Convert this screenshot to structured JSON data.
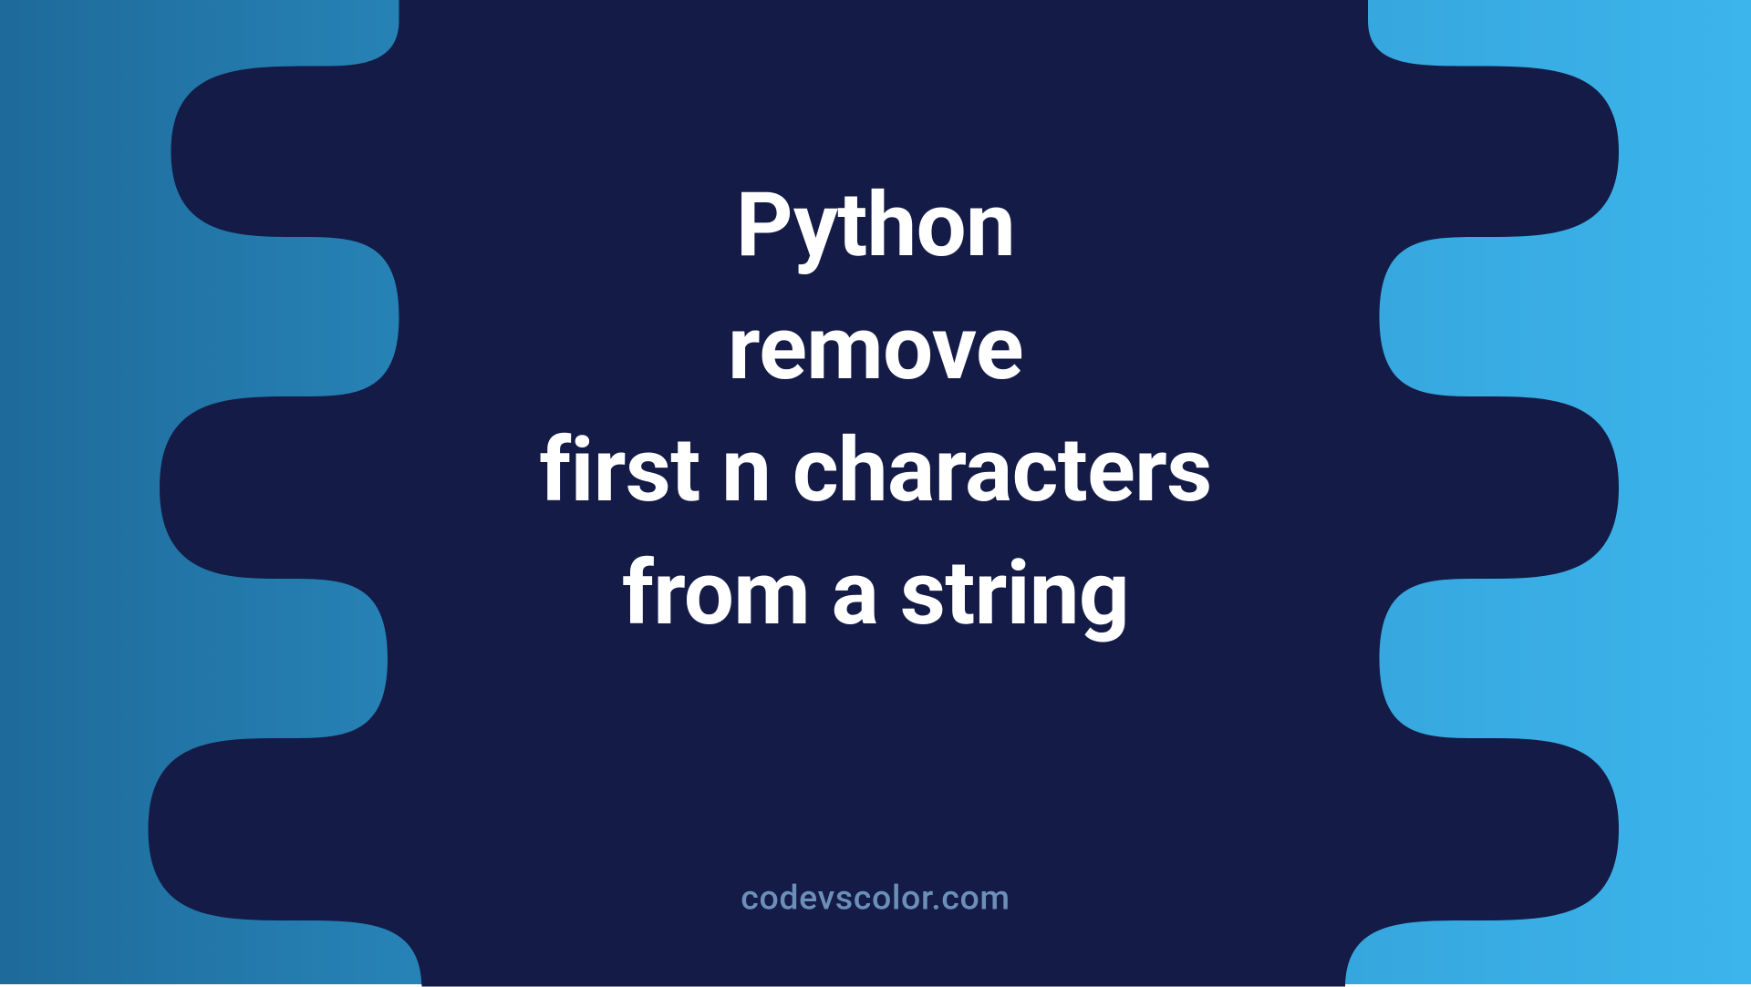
{
  "title": {
    "line1": "Python",
    "line2": "remove",
    "line3": "first n characters",
    "line4": "from a string"
  },
  "footer": "codevscolor.com",
  "colors": {
    "blob": "#131b46",
    "text": "#ffffff",
    "footer": "#6b8fb8",
    "bg_left": "#1e6a9a",
    "bg_right": "#3cb4ec"
  }
}
